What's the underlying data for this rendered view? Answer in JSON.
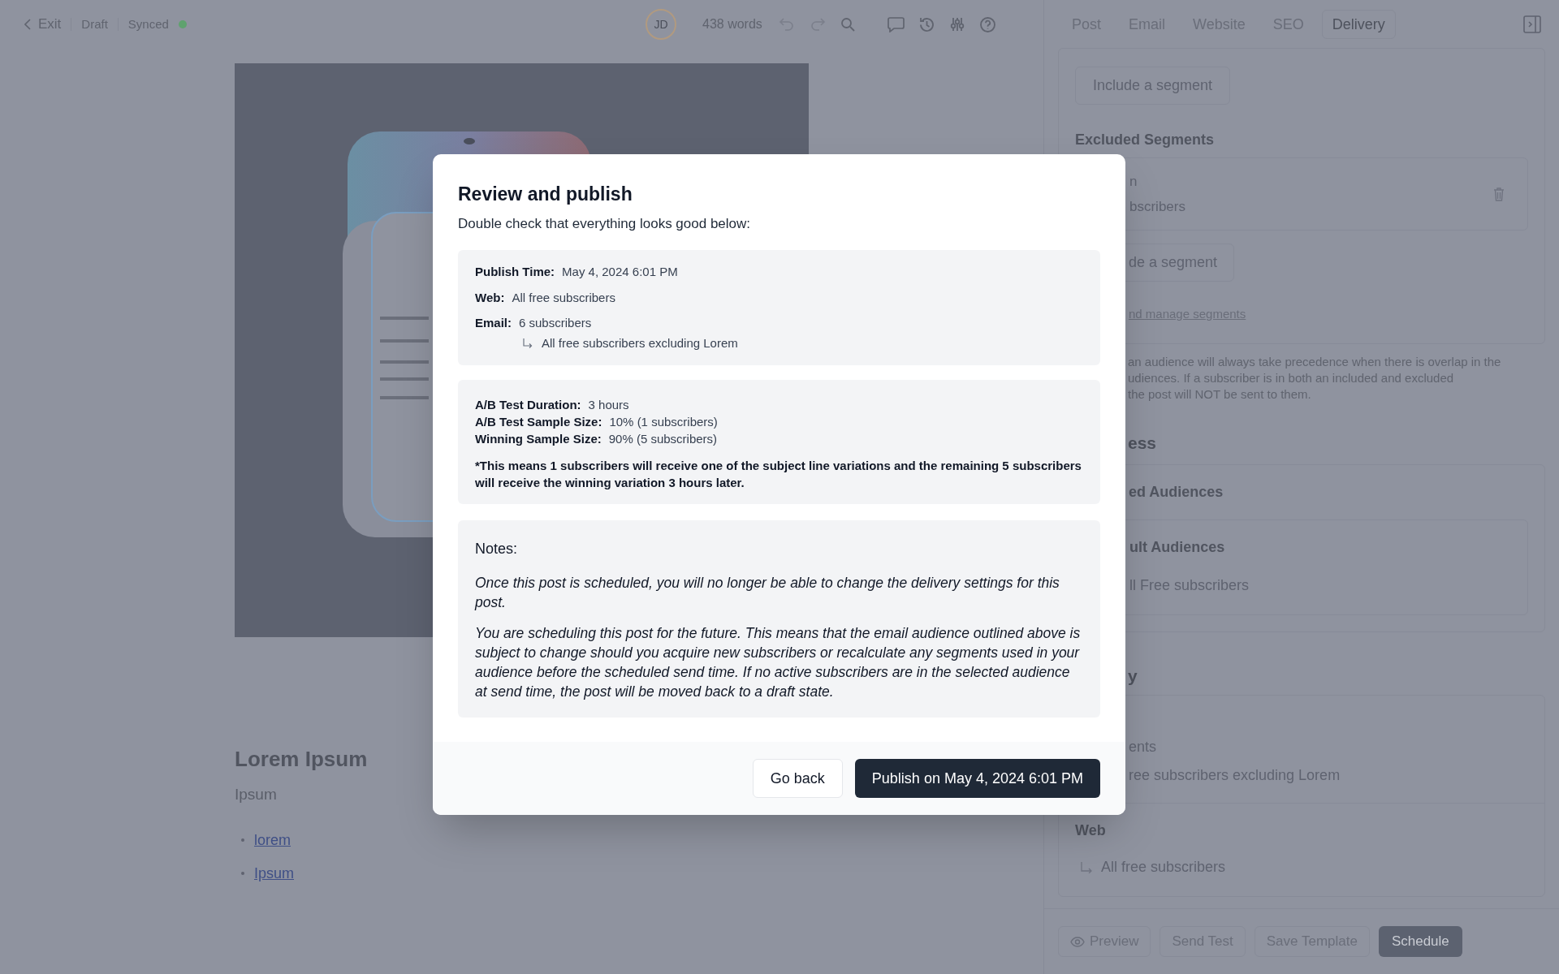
{
  "top_bar": {
    "back": "Exit",
    "status": "Draft",
    "sync": "Synced",
    "synced": true,
    "avatar": "JD",
    "word_count": "438 words"
  },
  "tabs": [
    {
      "label": "Post",
      "selected": false
    },
    {
      "label": "Email",
      "selected": false
    },
    {
      "label": "Website",
      "selected": false
    },
    {
      "label": "SEO",
      "selected": false
    },
    {
      "label": "Delivery",
      "selected": true
    }
  ],
  "editor": {
    "heading": "Lorem Ipsum",
    "subtitle": "Ipsum",
    "links": [
      "lorem",
      "Ipsum"
    ]
  },
  "sidebar": {
    "include_button": "Include a segment",
    "excluded_heading": "Excluded Segments",
    "excluded_segment": [
      "n",
      "bscribers"
    ],
    "exclude_button": "de a segment",
    "manage_link": "nd manage segments",
    "precedence_note": [
      "an audience will always take precedence when there is overlap in the",
      "udiences. If a subscriber is in both an included and excluded",
      "the post will NOT be sent to them."
    ],
    "section_2_heading": "ess",
    "audiences_heading": "ed Audiences",
    "default_heading": "ult Audiences",
    "default_value": "ll Free subscribers",
    "section_3_heading": "y",
    "email_label": "ents",
    "email_value": "ree subscribers excluding Lorem",
    "web_label": "Web",
    "web_value": "All free subscribers"
  },
  "footer_buttons": [
    {
      "label": "Preview",
      "kind": "preview"
    },
    {
      "label": "Send Test",
      "kind": "plain"
    },
    {
      "label": "Save Template",
      "kind": "plain"
    },
    {
      "label": "Schedule",
      "kind": "primary"
    }
  ],
  "modal": {
    "title": "Review and publish",
    "subtitle": "Double check that everything looks good below:",
    "summary": [
      {
        "label": "Publish Time:",
        "value": "May 4, 2024 6:01 PM"
      },
      {
        "label": "Web:",
        "value": "All free subscribers"
      },
      {
        "label": "Email:",
        "value": "6 subscribers",
        "sub_value": "All free subscribers excluding Lorem"
      }
    ],
    "ab_test": [
      {
        "label": "A/B Test Duration:",
        "value": "3 hours"
      },
      {
        "label": "A/B Test Sample Size:",
        "value": "10% (1 subscribers)"
      },
      {
        "label": "Winning Sample Size:",
        "value": "90% (5 subscribers)"
      }
    ],
    "ab_note": "*This means 1 subscribers will receive one of the subject line variations and the remaining 5 subscribers will receive the winning variation 3 hours later.",
    "notes_heading": "Notes:",
    "notes": [
      "Once this post is scheduled, you will no longer be able to change the delivery settings for this post.",
      "You are scheduling this post for the future. This means that the email audience outlined above is subject to change should you acquire new subscribers or recalculate any segments used in your audience before the scheduled send time. If no active subscribers are in the selected audience at send time, the post will be moved back to a draft state."
    ],
    "cancel_button": "Go back",
    "confirm_button": "Publish on May 4, 2024 6:01 PM"
  }
}
